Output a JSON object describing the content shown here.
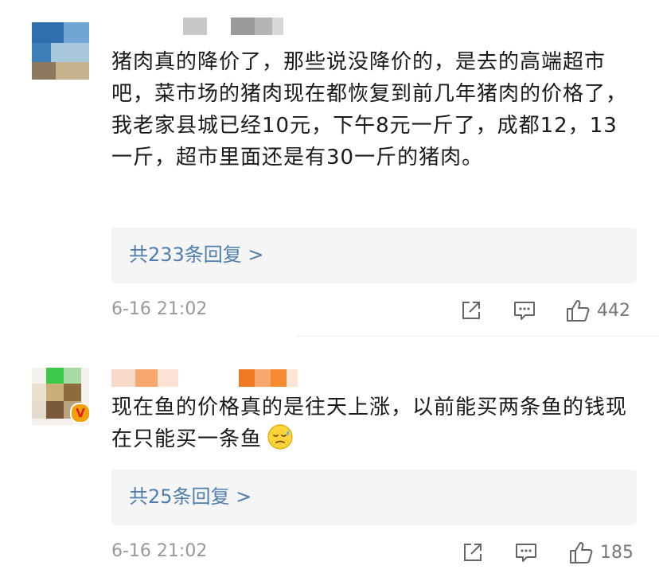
{
  "comments": [
    {
      "text": "猪肉真的降价了，那些说没降价的，是去的高端超市吧，菜市场的猪肉现在都恢复到前几年猪肉的价格了，我老家县城已经10元，下午8元一斤了，成都12，13一斤，超市里面还是有30一斤的猪肉。",
      "reply_link": "共233条回复 >",
      "timestamp": "6-16 21:02",
      "likes": "442"
    },
    {
      "text": "现在鱼的价格真的是往天上涨，以前能买两条鱼的钱现在只能买一条鱼",
      "reply_link": "共25条回复 >",
      "timestamp": "6-16 21:02",
      "likes": "185",
      "emoji": "sweat-face-emoji"
    }
  ],
  "icons": {
    "share": "share-icon",
    "comment": "comment-icon",
    "like": "thumbs-up-icon",
    "verified": "verified-badge-icon"
  },
  "colors": {
    "link": "#507daf",
    "meta": "#999999",
    "reply_bg": "#f5f5f5",
    "badge": "#f3a10b"
  }
}
